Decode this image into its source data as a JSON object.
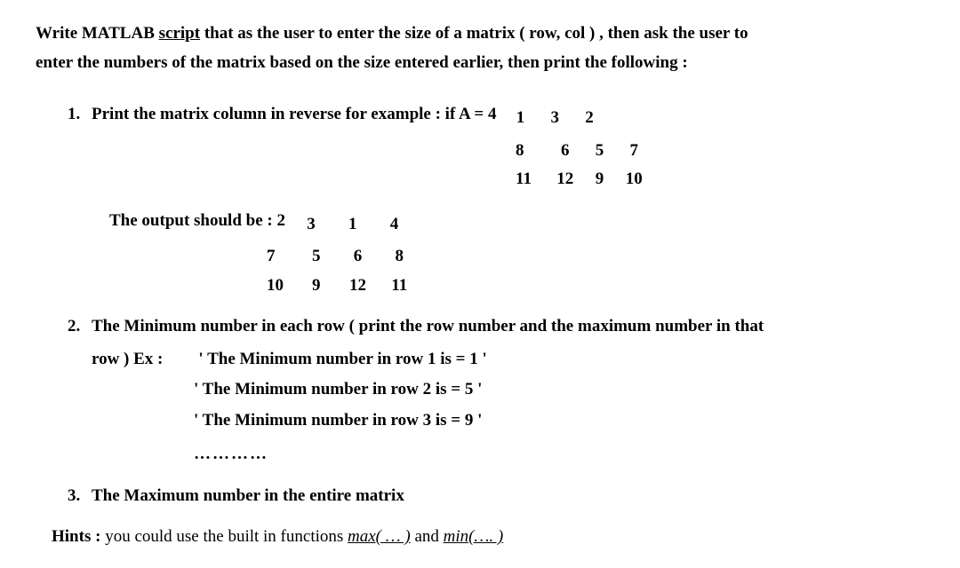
{
  "intro": {
    "line1_pre": "Write MATLAB ",
    "line1_script": "script",
    "line1_post": " that as the user to enter the size of a matrix ( row, col ) , then ask the user to",
    "line2": "enter the numbers of the matrix based on the size entered earlier, then print the following :"
  },
  "item1": {
    "text": "Print the matrix column in reverse for example : if A = 4",
    "matrixA": [
      [
        "1",
        "3",
        "2"
      ],
      [
        "8",
        "6",
        "5",
        "7"
      ],
      [
        "11",
        "12",
        "9",
        "10"
      ]
    ],
    "output_label": "The output should be : 2",
    "matrixOut": [
      [
        "3",
        "1",
        "4"
      ],
      [
        "7",
        "5",
        "6",
        "8"
      ],
      [
        "10",
        "9",
        "12",
        "11"
      ]
    ]
  },
  "item2": {
    "text": "The Minimum number in each row ( print the row number and the maximum number in that",
    "row_ex_label": "row ) Ex :",
    "ex1": "' The Minimum number in row 1 is = 1 '",
    "ex2": "' The Minimum number in row 2 is = 5 '",
    "ex3": "' The Minimum number in row 3 is = 9 '",
    "dots": "…………"
  },
  "item3": {
    "text": "The Maximum number in the entire matrix"
  },
  "hints": {
    "label": "Hints :",
    "text": " you could use the built in functions ",
    "fn1": "max( … )",
    "mid": "  and ",
    "fn2": "min(…. )"
  }
}
